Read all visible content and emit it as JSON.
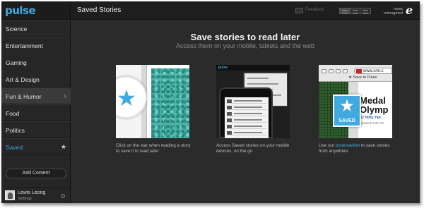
{
  "app": {
    "logo": "pulse",
    "page_title": "Saved Stories",
    "feedback_label": "Feedback",
    "news_label_line1": "news",
    "news_label_line2": "reimagined",
    "ie_glyph": "e"
  },
  "sidebar": {
    "items": [
      {
        "label": "Science"
      },
      {
        "label": "Entertainment"
      },
      {
        "label": "Gaming"
      },
      {
        "label": "Art & Design"
      },
      {
        "label": "Fun & Humor"
      },
      {
        "label": "Food"
      },
      {
        "label": "Politics"
      },
      {
        "label": "Saved"
      }
    ],
    "add_content_label": "Add Content",
    "user_name": "Lewis Leong",
    "user_settings": "Settings"
  },
  "main": {
    "headline": "Save stories to read later",
    "subhead": "Access them on your mobile, tablets and the web",
    "cards": [
      {
        "caption": "Click on the star when reading a story to save it to read later"
      },
      {
        "caption": "Access Saved stories on your mobile devices, on the go",
        "logo": "pulse"
      },
      {
        "caption_before": "Use our ",
        "caption_link": "bookmarklet",
        "caption_after": " to save stories from anywhere",
        "url_text": "www.cnn.c",
        "bookmark_label": "★ Save to Pulse",
        "headline": "Medal",
        "headline2": "Olymp",
        "byline_prefix": "By ",
        "byline_name": "Holly Yan",
        "updated": "updated 5:30 AM",
        "save_label": "SAVED"
      }
    ]
  },
  "colors": {
    "accent": "#3fa9e0",
    "sidebar_bg": "#262626",
    "main_bg": "#2b2b2b"
  },
  "icons": {
    "star": "star-icon",
    "chevron": "chevron-right-icon",
    "gear": "gear-icon"
  }
}
